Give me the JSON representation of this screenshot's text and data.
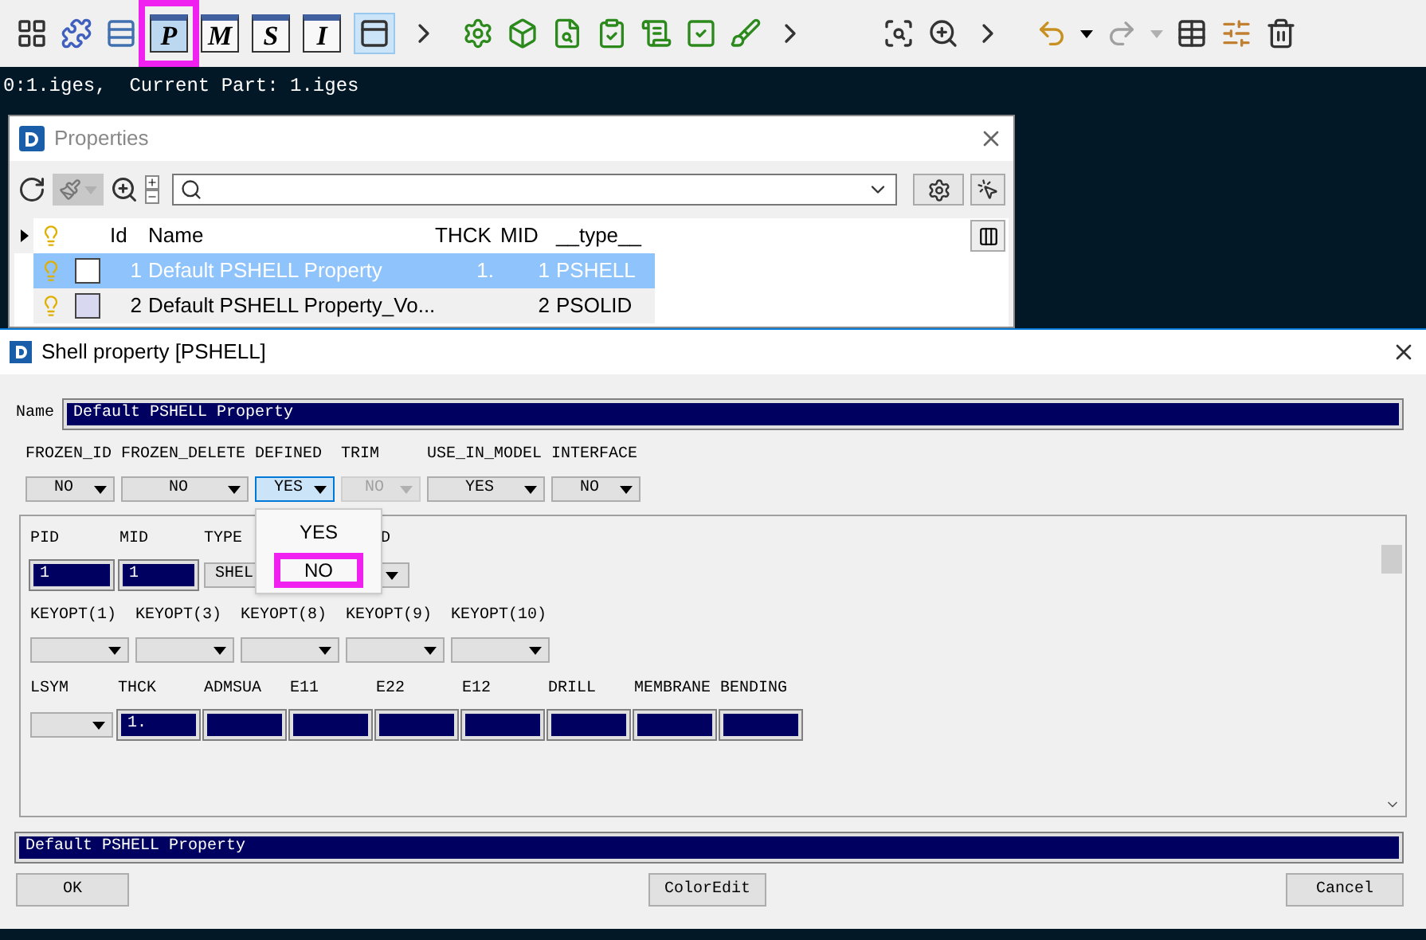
{
  "toolbar": {
    "letter_buttons": [
      {
        "label": "P",
        "selected": true,
        "highlighted": true
      },
      {
        "label": "M",
        "selected": false,
        "highlighted": false
      },
      {
        "label": "S",
        "selected": false,
        "highlighted": false
      },
      {
        "label": "I",
        "selected": false,
        "highlighted": false
      }
    ]
  },
  "status_text": "0:1.iges,  Current Part: 1.iges",
  "properties_window": {
    "title": "Properties",
    "columns": [
      "Id",
      "Name",
      "THCK",
      "MID",
      "__type__"
    ],
    "rows": [
      {
        "id": "1",
        "name": "Default PSHELL Property",
        "thck": "1.",
        "mid": "1",
        "type": "PSHELL",
        "color": "#ffffff",
        "selected": true
      },
      {
        "id": "2",
        "name": "Default PSHELL Property_Vo...",
        "mid": "2",
        "type": "PSOLID",
        "color": "#d8d8f0",
        "selected": false
      }
    ]
  },
  "dialog": {
    "title": "Shell property [PSHELL]",
    "name_label": "Name",
    "name_value": "Default PSHELL Property",
    "flags": [
      {
        "label": "FROZEN_ID",
        "value": "NO",
        "disabled": false,
        "focused": false
      },
      {
        "label": "FROZEN_DELETE",
        "value": "NO",
        "disabled": false,
        "focused": false
      },
      {
        "label": "DEFINED",
        "value": "YES",
        "disabled": false,
        "focused": true
      },
      {
        "label": "TRIM",
        "value": "NO",
        "disabled": true,
        "focused": false
      },
      {
        "label": "USE_IN_MODEL",
        "value": "YES",
        "disabled": false,
        "focused": false
      },
      {
        "label": "INTERFACE",
        "value": "NO",
        "disabled": false,
        "focused": false
      }
    ],
    "dropdown_options": [
      {
        "label": "YES",
        "highlighted": false
      },
      {
        "label": "NO",
        "highlighted": true
      }
    ],
    "pid_row": {
      "pid_label": "PID",
      "pid_value": "1",
      "mid_label": "MID",
      "mid_value": "1",
      "type_label": "TYPE",
      "type_value": "SHEL",
      "column_4_label": "D"
    },
    "keyopt_labels": [
      "KEYOPT(1)",
      "KEYOPT(3)",
      "KEYOPT(8)",
      "KEYOPT(9)",
      "KEYOPT(10)"
    ],
    "lsym_label": "LSYM",
    "value_fields": [
      {
        "label": "THCK",
        "value": "1."
      },
      {
        "label": "ADMSUA"
      },
      {
        "label": "E11"
      },
      {
        "label": "E22"
      },
      {
        "label": "E12"
      },
      {
        "label": "DRILL"
      },
      {
        "label": "MEMBRANE"
      },
      {
        "label": "BENDING"
      }
    ],
    "footer_name": "Default PSHELL Property",
    "buttons": [
      "OK",
      "ColorEdit",
      "Cancel"
    ]
  }
}
